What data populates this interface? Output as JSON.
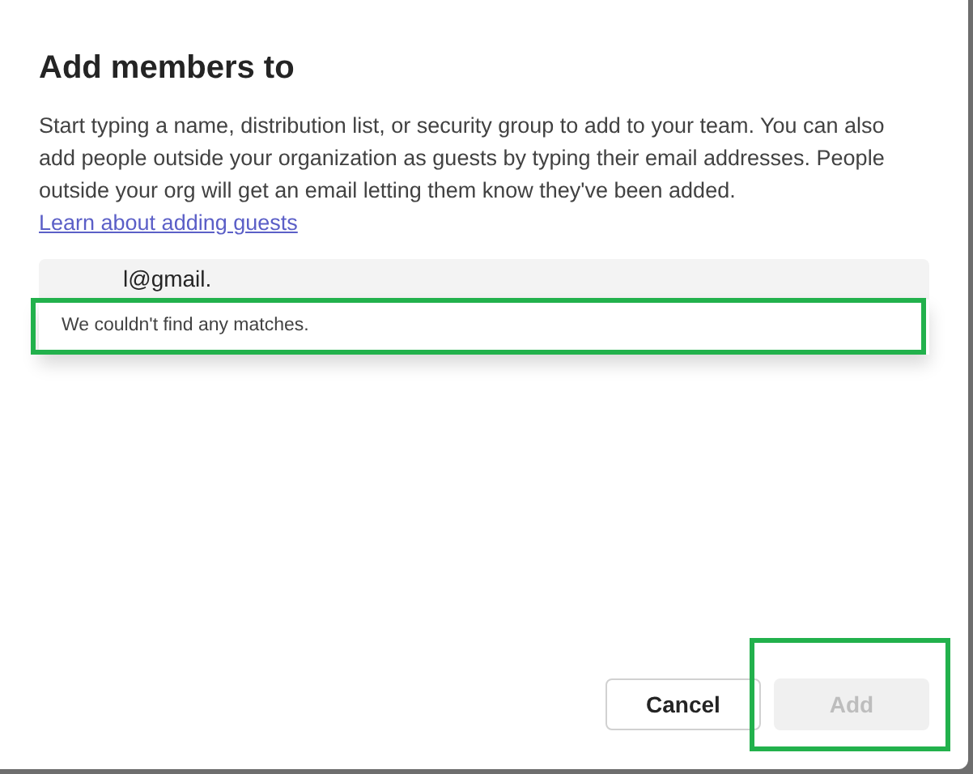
{
  "dialog": {
    "title": "Add members to",
    "description": "Start typing a name, distribution list, or security group to add to your team. You can also add people outside your organization as guests by typing their email addresses. People outside your org will get an email letting them know they've been added.",
    "link": "Learn about adding guests"
  },
  "people_picker": {
    "value": "l@gmail.",
    "suggestion": "We couldn't find any matches."
  },
  "buttons": [
    {
      "label": "Cancel",
      "kind": "secondary",
      "disabled": false
    },
    {
      "label": "Add",
      "kind": "primary",
      "disabled": true
    }
  ]
}
